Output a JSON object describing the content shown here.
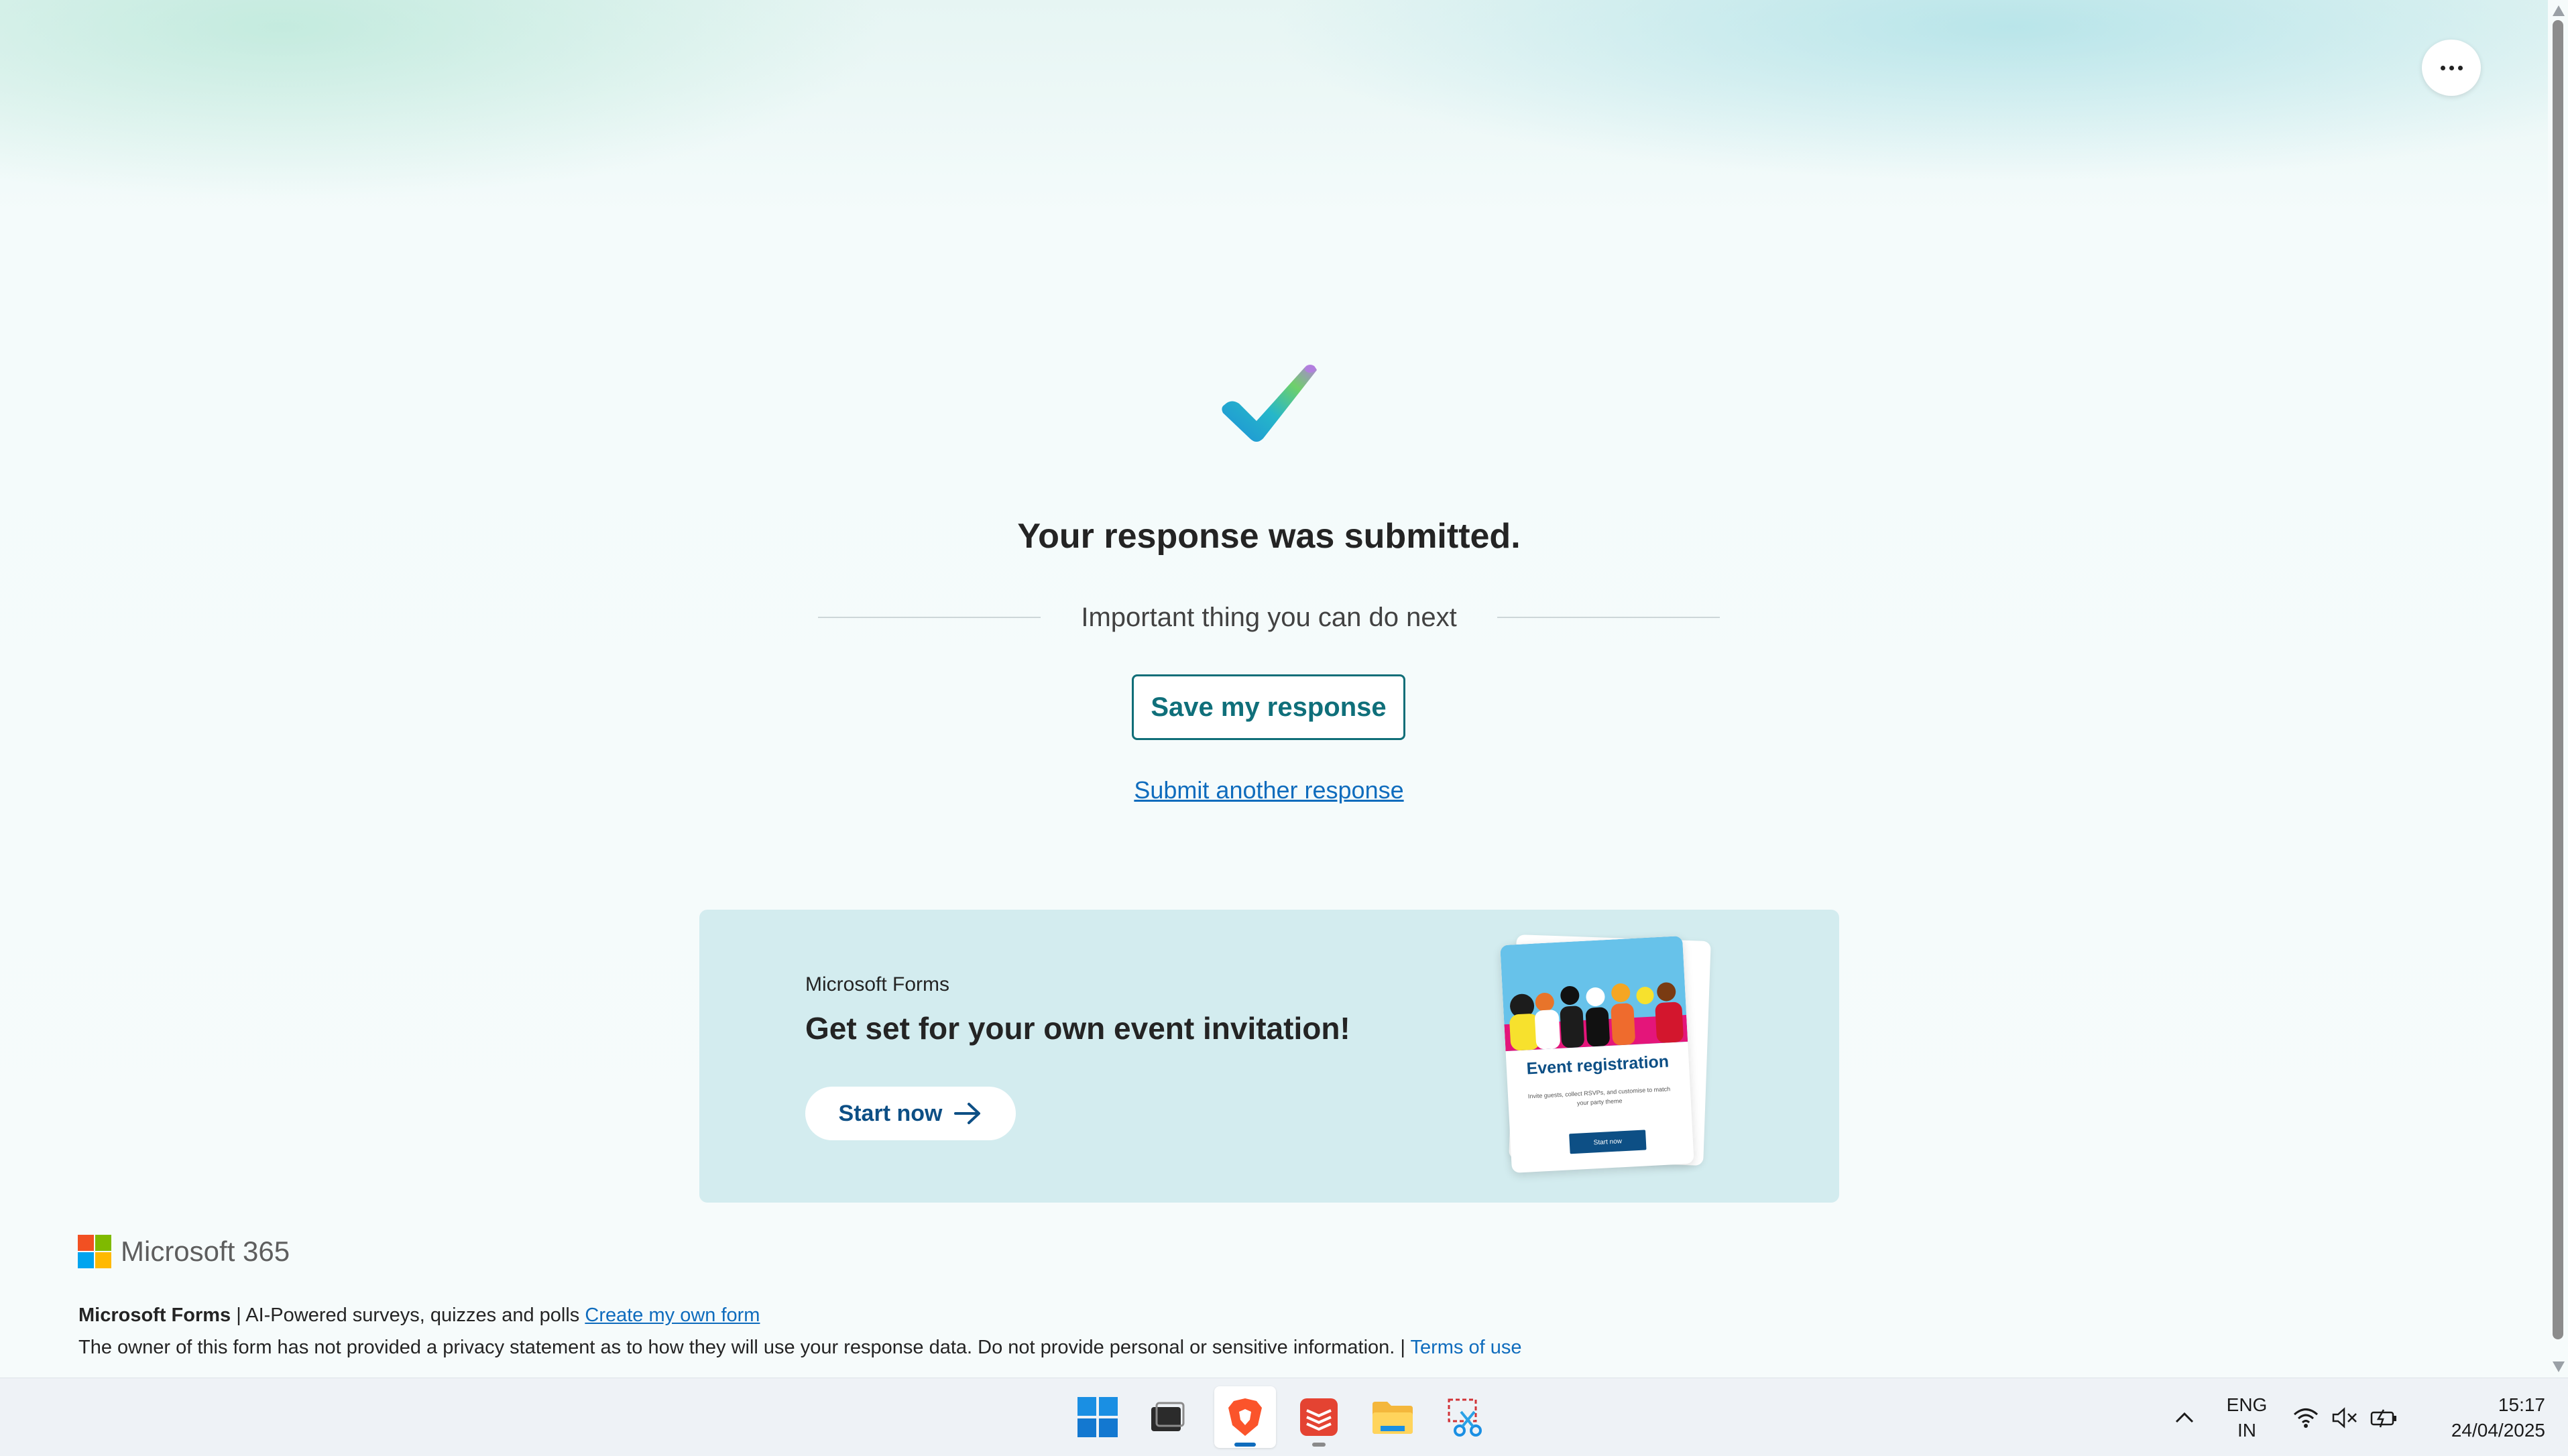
{
  "page": {
    "title": "Your response was submitted.",
    "next_label": "Important thing you can do next",
    "save_button": "Save my response",
    "another_link": "Submit another response"
  },
  "promo": {
    "brand": "Microsoft Forms",
    "headline": "Get set for your own event invitation!",
    "start_button": "Start now",
    "card_title": "Event registration",
    "card_subtitle": "Invite guests, collect RSVPs, and customise to match your party theme",
    "card_button": "Start now"
  },
  "footer": {
    "logo_text": "Microsoft 365",
    "forms_name": "Microsoft Forms",
    "forms_tagline": " | AI-Powered surveys, quizzes and polls ",
    "create_link": "Create my own form",
    "privacy_text": "The owner of this form has not provided a privacy statement as to how they will use your response data. Do not provide personal or sensitive information. | ",
    "terms_link": "Terms of use"
  },
  "taskbar": {
    "apps": [
      "start-icon",
      "task-view-icon",
      "brave-browser-icon",
      "todoist-icon",
      "file-explorer-icon",
      "snipping-tool-icon"
    ],
    "language_line1": "ENG",
    "language_line2": "IN",
    "time": "15:17",
    "date": "24/04/2025"
  },
  "colors": {
    "accent": "#0f6e78",
    "link": "#0f6cbd",
    "promo_bg": "#d3ecef",
    "promo_button_text": "#0d4f85"
  }
}
